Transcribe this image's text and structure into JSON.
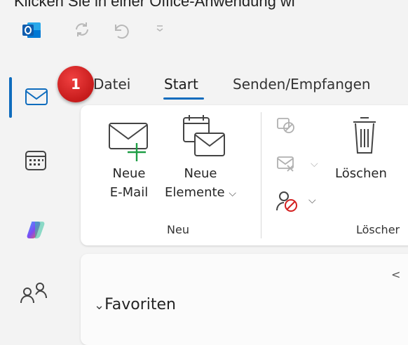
{
  "caption": "Klicken Sie in einer Office-Anwendung wi",
  "icons": {
    "app": "outlook-logo",
    "sync": "sync-icon",
    "undo": "undo-icon",
    "qat_more": "quick-access-more-icon",
    "mail": "mail-icon",
    "calendar": "calendar-icon",
    "copilot": "copilot-icon",
    "people": "people-icon"
  },
  "tabs": {
    "datei": "Datei",
    "start": "Start",
    "senden": "Senden/Empfangen"
  },
  "ribbon": {
    "new_email_line1": "Neue",
    "new_email_line2": "E-Mail",
    "new_items_line1": "Neue",
    "new_items_line2": "Elemente",
    "delete": "Löschen",
    "group_new": "Neu",
    "group_delete": "Löscher"
  },
  "folders": {
    "favorites": "Favoriten",
    "collapse": "<"
  },
  "badge": {
    "step": "1"
  },
  "colors": {
    "accent": "#0f6cbd",
    "badge": "#d42020"
  }
}
